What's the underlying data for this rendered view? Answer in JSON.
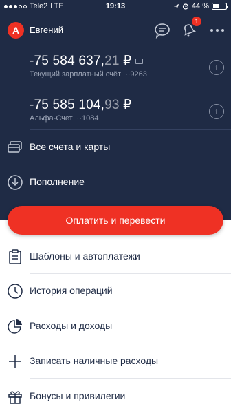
{
  "status_bar": {
    "carrier": "Tele2",
    "network": "LTE",
    "time": "19:13",
    "battery_text": "44 %",
    "battery_level": 0.44
  },
  "header": {
    "logo_letter": "А",
    "username": "Евгений",
    "notification_count": "1"
  },
  "accounts": [
    {
      "amount_main": "-75 584 637,",
      "amount_cents": "21",
      "currency": "₽",
      "name": "Текущий зарплатный счёт",
      "number": "··9263"
    },
    {
      "amount_main": "-75 585 104,",
      "amount_cents": "93",
      "currency": "₽",
      "name": "Альфа-Счет",
      "number": "··1084"
    }
  ],
  "dark_menu": [
    {
      "label": "Все счета и карты",
      "icon": "cards-icon"
    },
    {
      "label": "Пополнение",
      "icon": "download-icon"
    }
  ],
  "pay_button": {
    "label": "Оплатить и перевести"
  },
  "light_menu": [
    {
      "label": "Шаблоны и автоплатежи",
      "icon": "clipboard-icon"
    },
    {
      "label": "История операций",
      "icon": "clock-icon"
    },
    {
      "label": "Расходы и доходы",
      "icon": "pie-chart-icon"
    },
    {
      "label": "Записать наличные расходы",
      "icon": "plus-icon"
    },
    {
      "label": "Бонусы и привилегии",
      "icon": "gift-icon"
    }
  ],
  "colors": {
    "header_bg": "#1f2b45",
    "accent": "#ef3124",
    "text_dark": "#1f2b45"
  }
}
